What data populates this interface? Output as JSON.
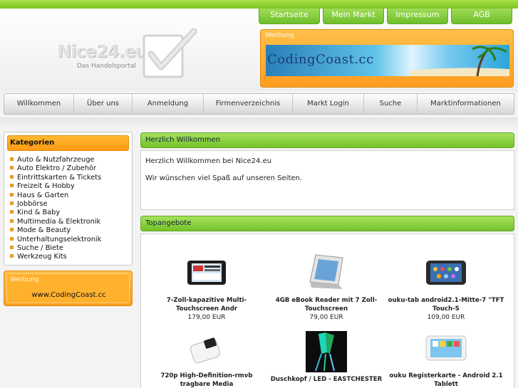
{
  "header": {
    "logo_title": "Nice24.eu",
    "logo_subtitle": "Das Handelsportal",
    "ad_label": "Werbung",
    "ad_banner_text": "CodingCoast.cc"
  },
  "top_nav": [
    "Startseite",
    "Mein Markt",
    "Impressum",
    "AGB"
  ],
  "main_nav": [
    "Willkommen",
    "Über uns",
    "Anmeldung",
    "Firmenverzeichnis",
    "Markt Login",
    "Suche",
    "Marktinformationen"
  ],
  "sidebar": {
    "title": "Kategorien",
    "items": [
      "Auto & Nutzfahrzeuge",
      "Auto Elektro / Zubehör",
      "Eintrittskarten & Tickets",
      "Freizeit & Hobby",
      "Haus & Garten",
      "Jobbörse",
      "Kind & Baby",
      "Multimedia & Elektronik",
      "Mode & Beauty",
      "Unterhaltungselektronik",
      "Suche / Biete",
      "Werkzeug Kits"
    ],
    "ad_label": "Werbung",
    "ad_link": "www.CodingCoast.cc"
  },
  "welcome": {
    "title": "Herzlich Willkommen",
    "line1": "Herzlich Willkommen bei Nice24.eu",
    "line2": "Wir wünschen viel Spaß auf unseren Seiten."
  },
  "top_offers": {
    "title": "Topangebote",
    "items": [
      {
        "name": "7-Zoll-kapazitive Multi-Touchscreen Andr",
        "price": "179,00 EUR",
        "icon": "tablet-icon"
      },
      {
        "name": "4GB eBook Reader mit 7 Zoll-Touchscreen",
        "price": "79,00 EUR",
        "icon": "ebook-reader-icon"
      },
      {
        "name": "ouku-tab android2.1-Mitte-7 \"TFT Touch-S",
        "price": "109,00 EUR",
        "icon": "android-tablet-icon"
      },
      {
        "name": "720p High-Definition-rmvb tragbare Media",
        "price": "",
        "icon": "media-player-icon"
      },
      {
        "name": "Duschkopf / LED - EASTCHESTER",
        "price": "",
        "icon": "shower-head-icon"
      },
      {
        "name": "ouku Registerkarte - Android 2.1 Tablett",
        "price": "",
        "icon": "white-tablet-icon"
      }
    ]
  },
  "colors": {
    "green_accent": "#7cc321",
    "orange_accent": "#ff9d1e",
    "background": "#f3f3f3"
  }
}
